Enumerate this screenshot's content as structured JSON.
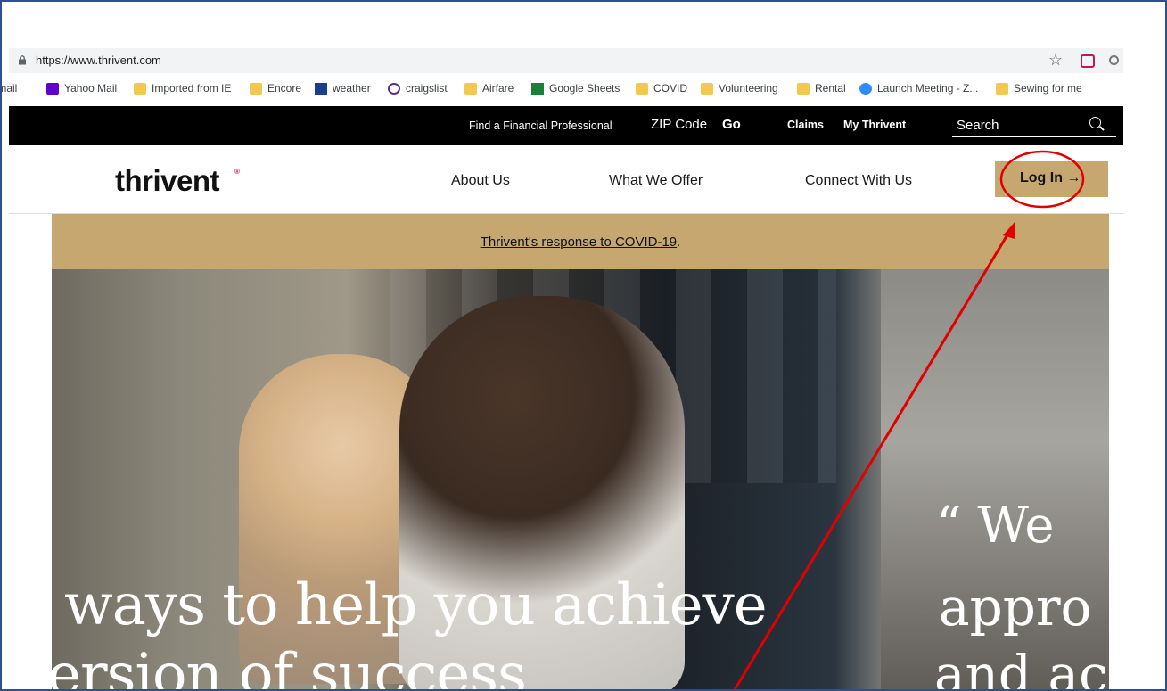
{
  "browser": {
    "url": "https://www.thrivent.com"
  },
  "bookmarks": [
    {
      "label": "Gmail",
      "icon": "mail-icon"
    },
    {
      "label": "Yahoo Mail",
      "icon": "mail-icon"
    },
    {
      "label": "Imported from IE",
      "icon": "folder-icon"
    },
    {
      "label": "Encore",
      "icon": "folder-icon"
    },
    {
      "label": "weather",
      "icon": "weather-icon"
    },
    {
      "label": "craigslist",
      "icon": "peace-icon"
    },
    {
      "label": "Airfare",
      "icon": "folder-icon"
    },
    {
      "label": "Google Sheets",
      "icon": "sheets-icon"
    },
    {
      "label": "COVID",
      "icon": "folder-icon"
    },
    {
      "label": "Volunteering",
      "icon": "folder-icon"
    },
    {
      "label": "Rental",
      "icon": "folder-icon"
    },
    {
      "label": "Launch Meeting - Z...",
      "icon": "zoom-icon"
    },
    {
      "label": "Sewing for me",
      "icon": "folder-icon"
    }
  ],
  "topbar": {
    "find_professional": "Find a Financial Professional",
    "zip_placeholder": "ZIP Code",
    "go": "Go",
    "claims": "Claims",
    "my_thrivent": "My Thrivent",
    "search_placeholder": "Search"
  },
  "nav": {
    "logo": "thrivent",
    "about": "About Us",
    "offer": "What We Offer",
    "connect": "Connect With Us",
    "login": "Log In →"
  },
  "banner": {
    "link": "Thrivent's response to COVID-19",
    "suffix": "."
  },
  "hero": {
    "line1": "ways to help you achieve",
    "line2": "version of success",
    "quote_line1": "“ We",
    "quote_line2": "appro",
    "quote_line3": "and ac"
  },
  "colors": {
    "gold": "#c5a76f",
    "annotation": "#e00000",
    "logo_accent": "#c4155a"
  }
}
